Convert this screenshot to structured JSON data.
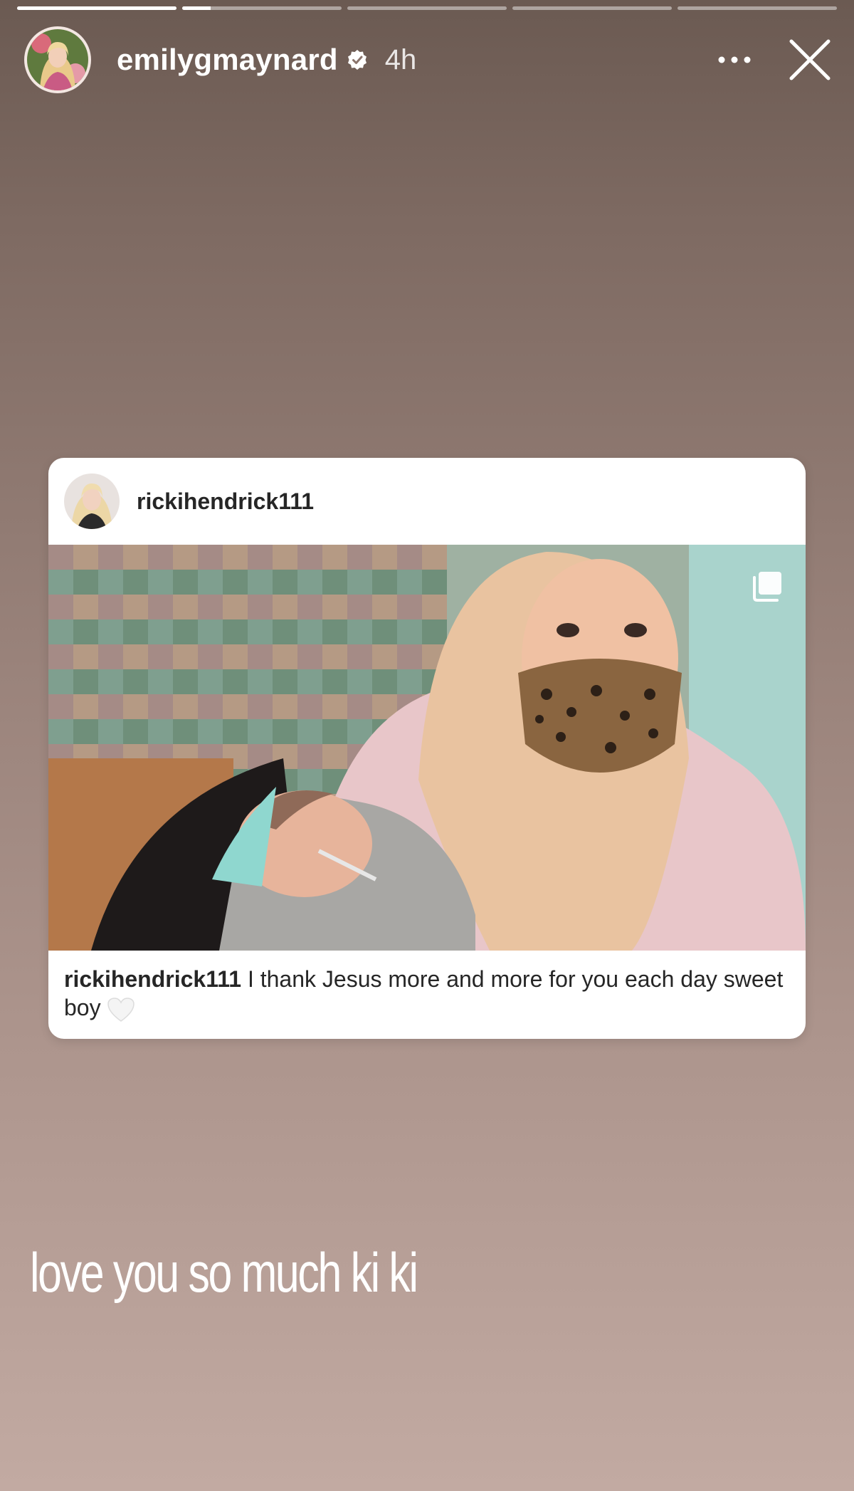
{
  "story": {
    "progress_segments": [
      {
        "fill": 1.0
      },
      {
        "fill": 0.18
      },
      {
        "fill": 0.0
      },
      {
        "fill": 0.0
      },
      {
        "fill": 0.0
      }
    ],
    "author": {
      "username": "emilygmaynard",
      "verified": true,
      "time_ago": "4h"
    },
    "icons": {
      "more": "more-dots-icon",
      "close": "close-icon",
      "verified": "verified-badge-icon",
      "multi_photo": "multiple-photos-icon",
      "heart": "white-heart-icon"
    },
    "shared_post": {
      "username": "rickihendrick111",
      "caption_user": "rickihendrick111",
      "caption_text": " I thank Jesus more and more for you each day sweet boy"
    },
    "overlay_text": "love you so much ki ki"
  },
  "colors": {
    "background_top": "#6b5a52",
    "background_bottom": "#c2aaa2",
    "card_bg": "#ffffff",
    "text_dark": "#262626"
  }
}
